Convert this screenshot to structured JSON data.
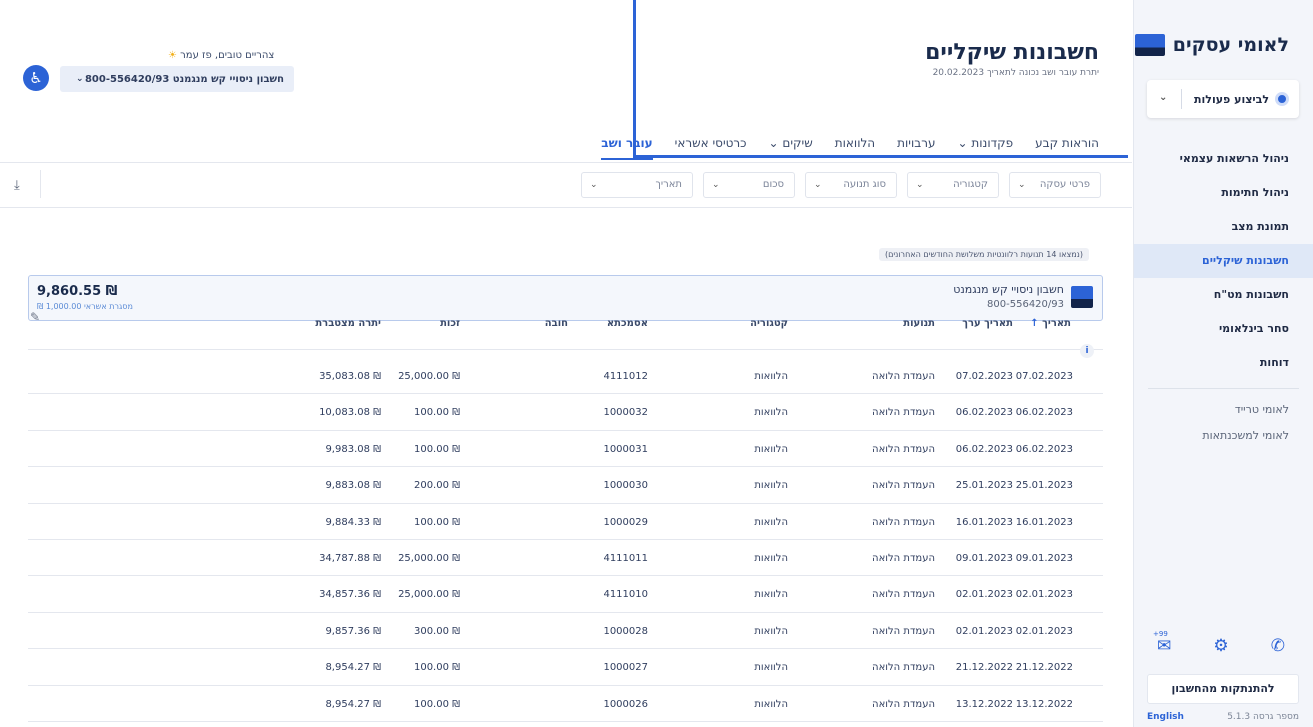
{
  "sidebar": {
    "logo_text": "לאומי עסקים",
    "actions_label": "לביצוע פעולות",
    "nav": [
      {
        "label": "ניהול הרשאות עצמאי",
        "active": false
      },
      {
        "label": "ניהול חתימות",
        "active": false
      },
      {
        "label": "תמונת מצב",
        "active": false
      },
      {
        "label": "חשבונות שיקליים",
        "active": true
      },
      {
        "label": "חשבונות מט\"ח",
        "active": false
      },
      {
        "label": "סחר בינלאומי",
        "active": false
      },
      {
        "label": "דוחות",
        "active": false
      }
    ],
    "links": [
      "לאומי טרייד",
      "לאומי למשכנתאות"
    ],
    "icons": [
      "mail-icon",
      "gear-icon",
      "phone-icon"
    ],
    "mail_badge": "+99",
    "logout_label": "להתנתקות מהחשבון",
    "version": "מספר גרסה 5.1.3",
    "language": "English"
  },
  "header": {
    "title": "חשבונות שיקליים",
    "subtitle": "יתרת עובר ושב נכונה לתאריך 20.02.2023",
    "greeting": "צהריים טובים, פז עמר",
    "account_select": "חשבון ניסויי קש מנגמנט  800-556420/93",
    "tabs": [
      {
        "label": "עובר ושב",
        "active": true
      },
      {
        "label": "כרטיסי אשראי",
        "active": false
      },
      {
        "label": "שיקים ⌄",
        "active": false
      },
      {
        "label": "הלוואות",
        "active": false
      },
      {
        "label": "ערבויות",
        "active": false
      },
      {
        "label": "פקדונות ⌄",
        "active": false
      },
      {
        "label": "הוראות קבע",
        "active": false
      }
    ]
  },
  "filters": [
    {
      "label": "תאריך"
    },
    {
      "label": "סכום"
    },
    {
      "label": "סוג תנועה"
    },
    {
      "label": "קטגוריה"
    },
    {
      "label": "פרטי עסקה"
    }
  ],
  "notice": "(נמצאו 14 תנועות רלוונטיות משלושת החודשים האחרונים)",
  "account_card": {
    "name": "חשבון ניסויי קש מנגמנט",
    "number": "800-556420/93",
    "balance": "₪ 9,860.55",
    "credit": "מסגרת אשראי 1,000.00 ₪"
  },
  "table": {
    "headers": {
      "date": "תאריך",
      "value_date": "תאריך ערך",
      "description": "תנועות",
      "category": "קטגוריה",
      "reference": "אסמכתא",
      "debit": "חובה",
      "credit": "זכות",
      "balance": "יתרה מצטברת"
    },
    "rows": [
      {
        "date": "07.02.2023",
        "value_date": "07.02.2023",
        "description": "העמדת הלואה",
        "category": "הלוואות",
        "reference": "4111012",
        "debit": "",
        "credit": "₪ 25,000.00",
        "balance": "₪ 35,083.08"
      },
      {
        "date": "06.02.2023",
        "value_date": "06.02.2023",
        "description": "העמדת הלואה",
        "category": "הלוואות",
        "reference": "1000032",
        "debit": "",
        "credit": "₪ 100.00",
        "balance": "₪ 10,083.08"
      },
      {
        "date": "06.02.2023",
        "value_date": "06.02.2023",
        "description": "העמדת הלואה",
        "category": "הלוואות",
        "reference": "1000031",
        "debit": "",
        "credit": "₪ 100.00",
        "balance": "₪ 9,983.08"
      },
      {
        "date": "25.01.2023",
        "value_date": "25.01.2023",
        "description": "העמדת הלואה",
        "category": "הלוואות",
        "reference": "1000030",
        "debit": "",
        "credit": "₪ 200.00",
        "balance": "₪ 9,883.08"
      },
      {
        "date": "16.01.2023",
        "value_date": "16.01.2023",
        "description": "העמדת הלואה",
        "category": "הלוואות",
        "reference": "1000029",
        "debit": "",
        "credit": "₪ 100.00",
        "balance": "₪ 9,884.33"
      },
      {
        "date": "09.01.2023",
        "value_date": "09.01.2023",
        "description": "העמדת הלואה",
        "category": "הלוואות",
        "reference": "4111011",
        "debit": "",
        "credit": "₪ 25,000.00",
        "balance": "₪ 34,787.88"
      },
      {
        "date": "02.01.2023",
        "value_date": "02.01.2023",
        "description": "העמדת הלואה",
        "category": "הלוואות",
        "reference": "4111010",
        "debit": "",
        "credit": "₪ 25,000.00",
        "balance": "₪ 34,857.36"
      },
      {
        "date": "02.01.2023",
        "value_date": "02.01.2023",
        "description": "העמדת הלואה",
        "category": "הלוואות",
        "reference": "1000028",
        "debit": "",
        "credit": "₪ 300.00",
        "balance": "₪ 9,857.36"
      },
      {
        "date": "21.12.2022",
        "value_date": "21.12.2022",
        "description": "העמדת הלואה",
        "category": "הלוואות",
        "reference": "1000027",
        "debit": "",
        "credit": "₪ 100.00",
        "balance": "₪ 8,954.27"
      },
      {
        "date": "13.12.2022",
        "value_date": "13.12.2022",
        "description": "העמדת הלואה",
        "category": "הלוואות",
        "reference": "1000026",
        "debit": "",
        "credit": "₪ 100.00",
        "balance": "₪ 8,954.27"
      }
    ]
  },
  "colors": {
    "accent": "#2c63d6",
    "brand_dark": "#12244a",
    "sidebar_bg": "#f3f5fa"
  }
}
